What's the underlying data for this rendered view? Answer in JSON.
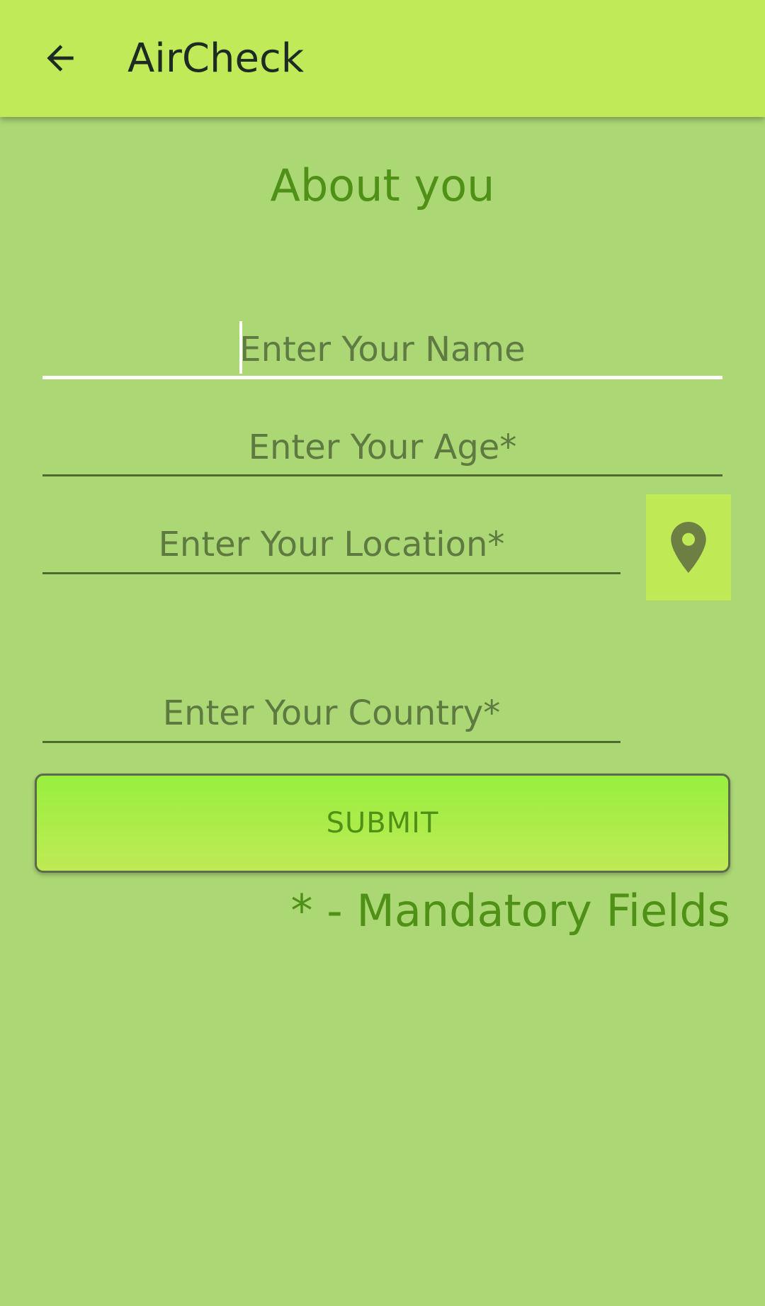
{
  "app_bar": {
    "title": "AirCheck",
    "back_icon": "arrow-left-icon",
    "background": "#c0ea58"
  },
  "section": {
    "title": "About you"
  },
  "form": {
    "name_placeholder": "Enter Your Name",
    "age_placeholder": "Enter Your Age*",
    "location_placeholder": "Enter Your Location*",
    "country_placeholder": "Enter Your Country*",
    "location_button_icon": "map-pin-icon",
    "submit_label": "SUBMIT"
  },
  "footer": {
    "mandatory_note": "* - Mandatory Fields"
  },
  "colors": {
    "page_background": "#acd775",
    "accent_green": "#4f9117",
    "location_button": "#bfea55"
  }
}
